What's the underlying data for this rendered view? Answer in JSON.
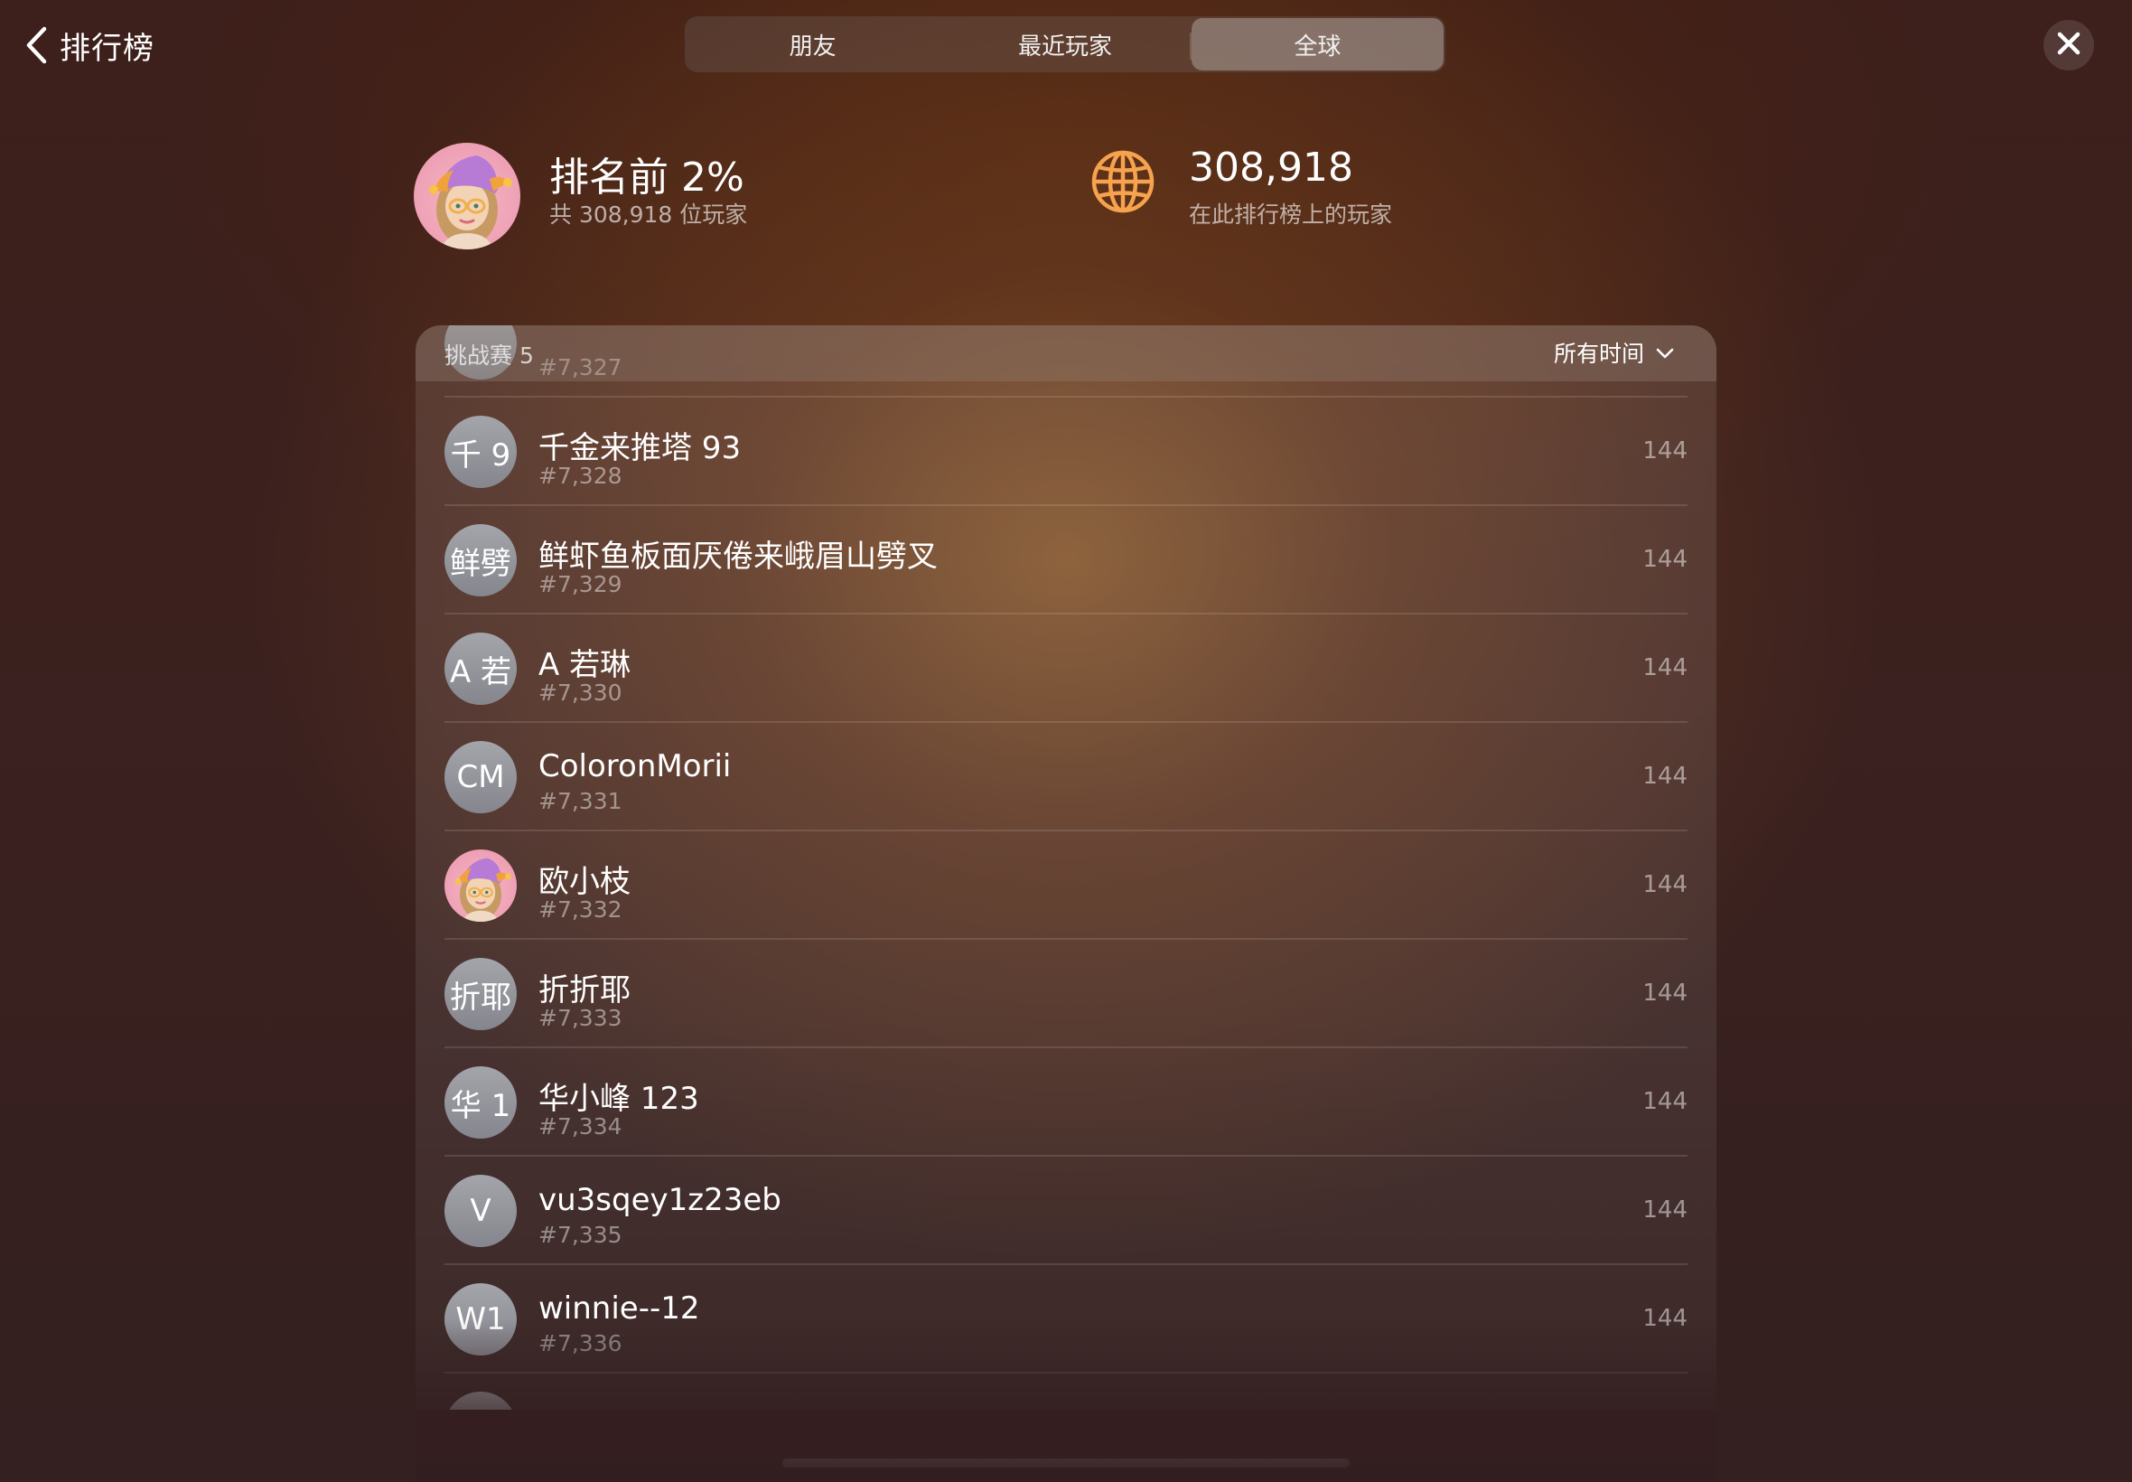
{
  "nav": {
    "back_label": "排行榜",
    "tabs": [
      {
        "label": "朋友"
      },
      {
        "label": "最近玩家"
      },
      {
        "label": "全球"
      }
    ],
    "active_tab": "全球"
  },
  "summary": {
    "my_rank_title": "排名前 2%",
    "my_rank_sub": "共 308,918 位玩家",
    "total_players": "308,918",
    "total_players_sub": "在此排行榜上的玩家"
  },
  "leaderboard": {
    "title": "挑战赛 5",
    "time_filter": "所有时间",
    "rows": [
      {
        "initials": "",
        "name": "",
        "rank": "#7,327",
        "score": ""
      },
      {
        "initials": "千 9",
        "name": "千金来推塔 93",
        "rank": "#7,328",
        "score": "144"
      },
      {
        "initials": "鲜劈",
        "name": "鲜虾鱼板面厌倦来峨眉山劈叉",
        "rank": "#7,329",
        "score": "144"
      },
      {
        "initials": "A 若",
        "name": "A 若琳",
        "rank": "#7,330",
        "score": "144"
      },
      {
        "initials": "CM",
        "name": "ColoronMorii",
        "rank": "#7,331",
        "score": "144"
      },
      {
        "initials": "",
        "name": "欧小枝",
        "rank": "#7,332",
        "score": "144",
        "memoji": true
      },
      {
        "initials": "折耶",
        "name": "折折耶",
        "rank": "#7,333",
        "score": "144"
      },
      {
        "initials": "华 1",
        "name": "华小峰 123",
        "rank": "#7,334",
        "score": "144"
      },
      {
        "initials": "V",
        "name": "vu3sqey1z23eb",
        "rank": "#7,335",
        "score": "144"
      },
      {
        "initials": "W1",
        "name": "winnie--12",
        "rank": "#7,336",
        "score": "144"
      },
      {
        "initials": "",
        "name": "",
        "rank": "",
        "score": ""
      }
    ]
  },
  "colors": {
    "accent_globe": "#f6a24e",
    "background_dark": "#3b211f"
  },
  "icons": {
    "back": "chevron-left-icon",
    "close": "close-icon",
    "globe": "globe-icon",
    "dropdown": "chevron-down-icon"
  }
}
